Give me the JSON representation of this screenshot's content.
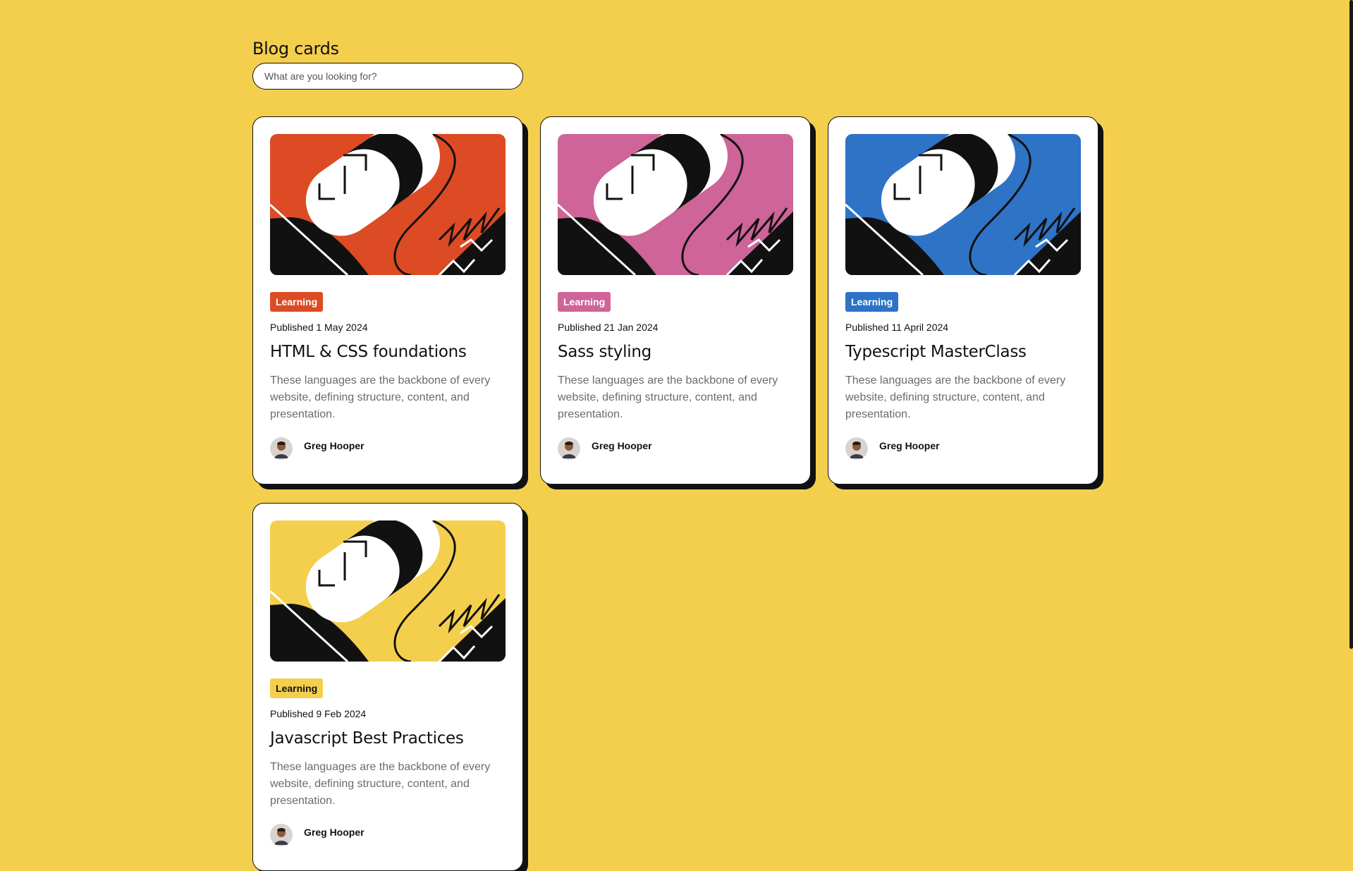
{
  "page": {
    "title": "Blog cards",
    "search_placeholder": "What are you looking for?"
  },
  "colors": {
    "background": "#f4cf4e",
    "orange": "#dc4b24",
    "pink": "#ce6497",
    "blue": "#2e73c6",
    "yellow": "#f4cf4e"
  },
  "cards": [
    {
      "badge": "Learning",
      "published": "Published 1 May 2024",
      "title": "HTML & CSS foundations",
      "excerpt": "These languages are the backbone of every website, defining structure, content, and presentation.",
      "author": "Greg Hooper",
      "color": "#dc4b24",
      "badge_text_color": "#ffffff"
    },
    {
      "badge": "Learning",
      "published": "Published 21 Jan 2024",
      "title": "Sass styling",
      "excerpt": "These languages are the backbone of every website, defining structure, content, and presentation.",
      "author": "Greg Hooper",
      "color": "#ce6497",
      "badge_text_color": "#ffffff"
    },
    {
      "badge": "Learning",
      "published": "Published 11 April 2024",
      "title": "Typescript MasterClass",
      "excerpt": "These languages are the backbone of every website, defining structure, content, and presentation.",
      "author": "Greg Hooper",
      "color": "#2e73c6",
      "badge_text_color": "#ffffff"
    },
    {
      "badge": "Learning",
      "published": "Published 9 Feb 2024",
      "title": "Javascript Best Practices",
      "excerpt": "These languages are the backbone of every website, defining structure, content, and presentation.",
      "author": "Greg Hooper",
      "color": "#f4cf4e",
      "badge_text_color": "#111111"
    }
  ]
}
